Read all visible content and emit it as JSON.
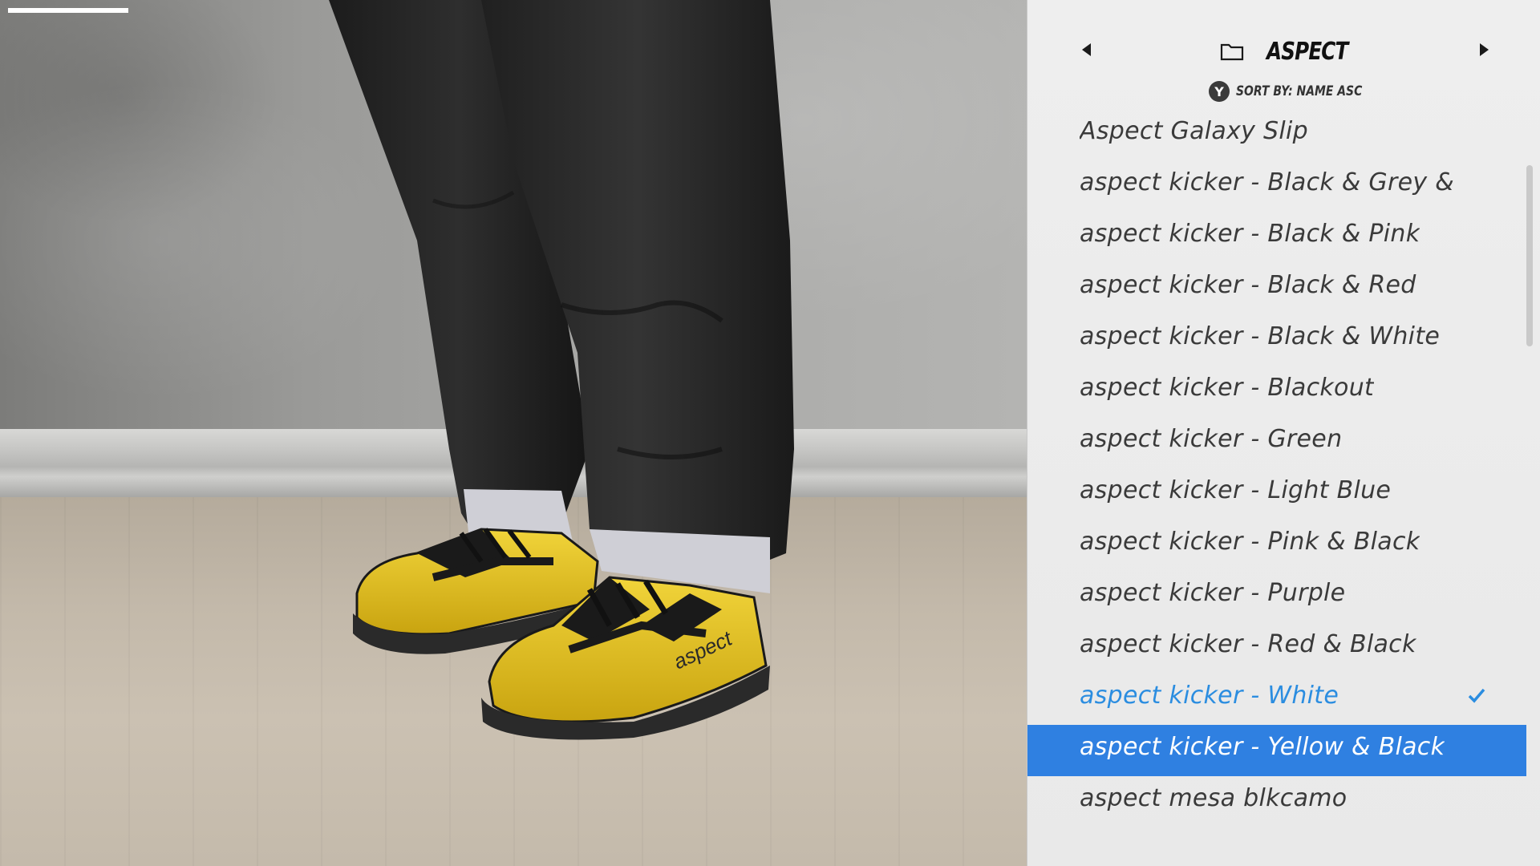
{
  "header": {
    "title": "ASPECT",
    "sort_badge": "Y",
    "sort_label": "SORT BY: NAME ASC"
  },
  "list": {
    "items": [
      {
        "label": "Aspect Galaxy Slip",
        "state": "normal"
      },
      {
        "label": "aspect kicker - Black & Grey & I",
        "state": "normal"
      },
      {
        "label": "aspect kicker - Black & Pink",
        "state": "normal"
      },
      {
        "label": "aspect kicker - Black & Red",
        "state": "normal"
      },
      {
        "label": "aspect kicker - Black & White",
        "state": "normal"
      },
      {
        "label": "aspect kicker - Blackout",
        "state": "normal"
      },
      {
        "label": "aspect kicker - Green",
        "state": "normal"
      },
      {
        "label": "aspect kicker - Light Blue",
        "state": "normal"
      },
      {
        "label": "aspect kicker - Pink & Black",
        "state": "normal"
      },
      {
        "label": "aspect kicker - Purple",
        "state": "normal"
      },
      {
        "label": "aspect kicker - Red & Black",
        "state": "normal"
      },
      {
        "label": "aspect kicker - White",
        "state": "active"
      },
      {
        "label": "aspect kicker - Yellow & Black",
        "state": "hovered"
      },
      {
        "label": "aspect mesa blkcamo",
        "state": "normal"
      }
    ]
  },
  "scene": {
    "shoe_logo": "aspect",
    "progress": 1.0
  },
  "colors": {
    "accent": "#2f80e1",
    "active_text": "#2b8de0",
    "shoe_yellow": "#e8c21a"
  },
  "icons": {
    "folder": "folder-icon",
    "check": "check-icon",
    "prev": "triangle-left-icon",
    "next": "triangle-right-icon"
  }
}
